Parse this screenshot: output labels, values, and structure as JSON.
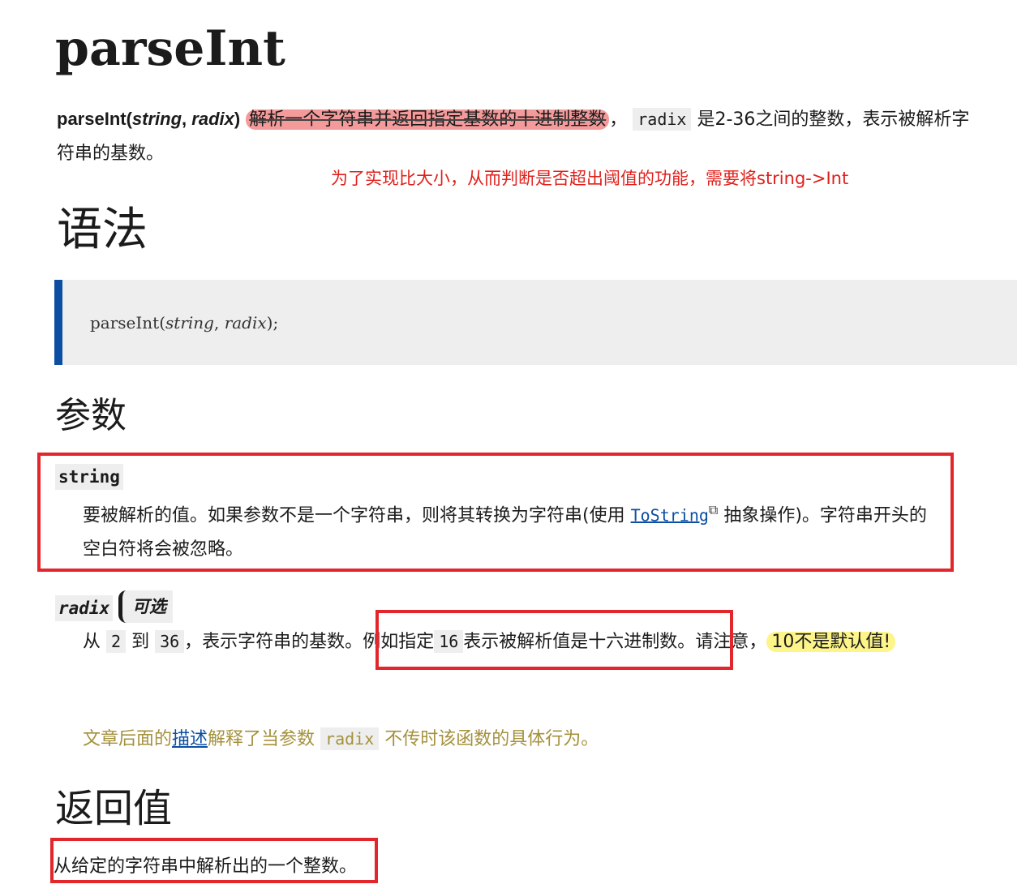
{
  "title": "parseInt",
  "summary": {
    "signature_fn": "parseInt(",
    "signature_arg1": "string",
    "signature_sep": ", ",
    "signature_arg2": "radix",
    "signature_close": ")",
    "highlight_text": "解析一个字符串并返回指定基数的十进制整数",
    "comma": "，",
    "radix_code": "radix",
    "after_code": "是2-36之间的整数，表示被解析字符串的基数。"
  },
  "annotation_red": "为了实现比大小，从而判断是否超出阈值的功能，需要将string->Int",
  "syntax": {
    "heading": "语法",
    "code_fn": "parseInt(",
    "code_arg1": "string",
    "code_sep": ",  ",
    "code_arg2": "radix",
    "code_end": ");"
  },
  "params": {
    "heading": "参数",
    "string": {
      "name": "string",
      "desc_before": "要被解析的值。如果参数不是一个字符串，则将其转换为字符串(使用 ",
      "link": "ToString",
      "desc_after": " 抽象操作)。字符串开头的空白符将会被忽略。"
    },
    "radix": {
      "name": "radix",
      "badge": "可选",
      "from": "从",
      "min": "2",
      "to": "到",
      "max": "36",
      "part1": "，表示字符串的基数。",
      "part2a": "例如指定",
      "hex": "16",
      "part2b": "表示被解析值是十六进制数。",
      "part3": "请注意，",
      "highlight": "10不是默认值!",
      "note_before": "文章后面的",
      "note_link": "描述",
      "note_middle": "解释了当参数",
      "note_code": "radix",
      "note_after": "不传时该函数的具体行为。"
    }
  },
  "return_value": {
    "heading": "返回值",
    "desc": "从给定的字符串中解析出的一个整数。"
  },
  "colors": {
    "accent_blue": "#0b4ea2",
    "annotation_red": "#e0201c",
    "box_red": "#e3262b",
    "highlight_yellow": "#fdf58a",
    "highlight_red": "#f07878",
    "note_olive": "#a4913c"
  },
  "icons": [
    "external-link-icon"
  ]
}
